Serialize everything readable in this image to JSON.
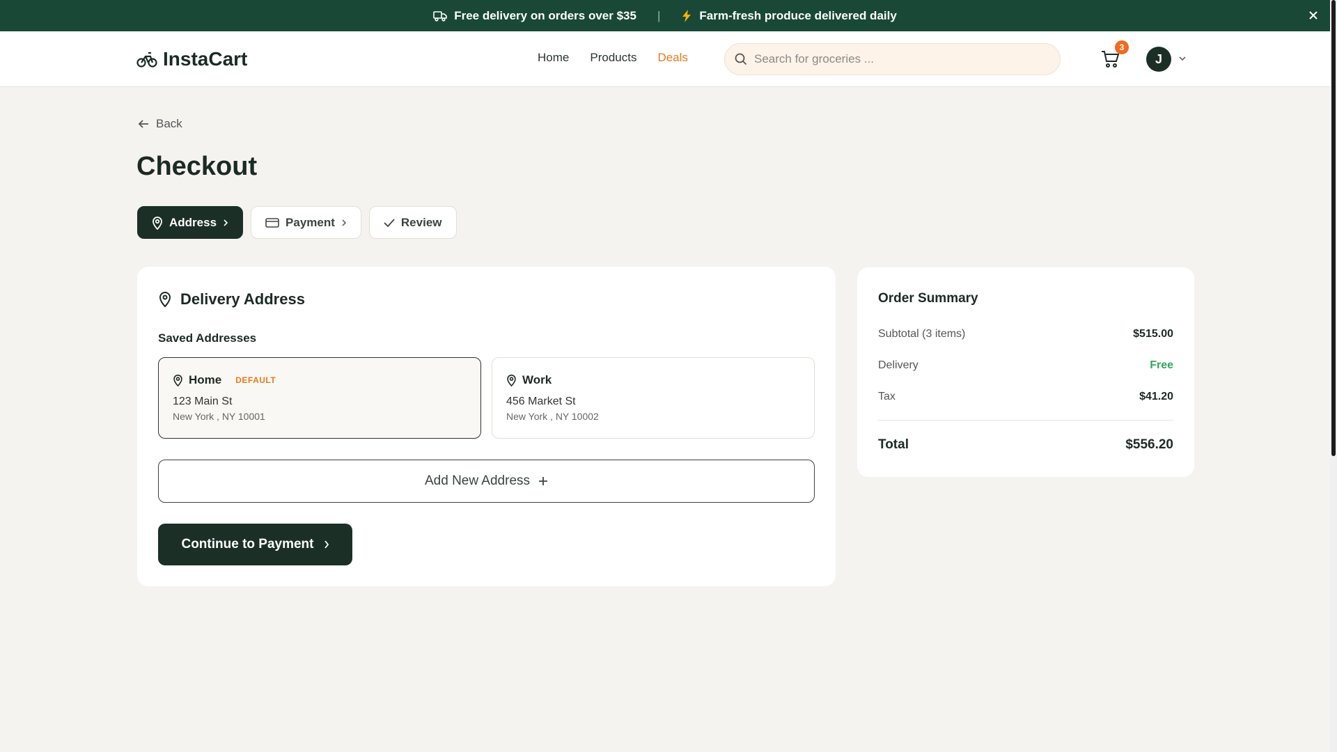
{
  "announcement": {
    "left_text": "Free delivery on orders over $35",
    "separator": "|",
    "right_text": "Farm-fresh produce delivered daily"
  },
  "header": {
    "brand": "InstaCart",
    "nav": [
      {
        "label": "Home",
        "active": false
      },
      {
        "label": "Products",
        "active": false
      },
      {
        "label": "Deals",
        "active": true
      }
    ],
    "search_placeholder": "Search for groceries ...",
    "cart_count": "3",
    "avatar_initial": "J"
  },
  "page": {
    "back_label": "Back",
    "title": "Checkout",
    "steps": [
      {
        "label": "Address",
        "icon": "map-pin-icon",
        "active": true
      },
      {
        "label": "Payment",
        "icon": "credit-card-icon",
        "active": false
      },
      {
        "label": "Review",
        "icon": "check-icon",
        "active": false
      }
    ]
  },
  "delivery": {
    "title": "Delivery Address",
    "saved_label": "Saved Addresses",
    "addresses": [
      {
        "name": "Home",
        "badge": "DEFAULT",
        "line1": "123 Main St",
        "line2": "New York , NY 10001",
        "selected": true
      },
      {
        "name": "Work",
        "badge": "",
        "line1": "456 Market St",
        "line2": "New York , NY 10002",
        "selected": false
      }
    ],
    "add_label": "Add New Address",
    "continue_label": "Continue to Payment"
  },
  "summary": {
    "title": "Order Summary",
    "rows": [
      {
        "label": "Subtotal (3 items)",
        "value": "$515.00"
      },
      {
        "label": "Delivery",
        "value": "Free"
      },
      {
        "label": "Tax",
        "value": "$41.20"
      }
    ],
    "total_label": "Total",
    "total_value": "$556.20"
  },
  "colors": {
    "brand_dark": "#194837",
    "button_dark": "#1b2f27",
    "accent_orange": "#e67a1e",
    "free_green": "#2fa85a",
    "page_bg": "#f5f3f0"
  }
}
